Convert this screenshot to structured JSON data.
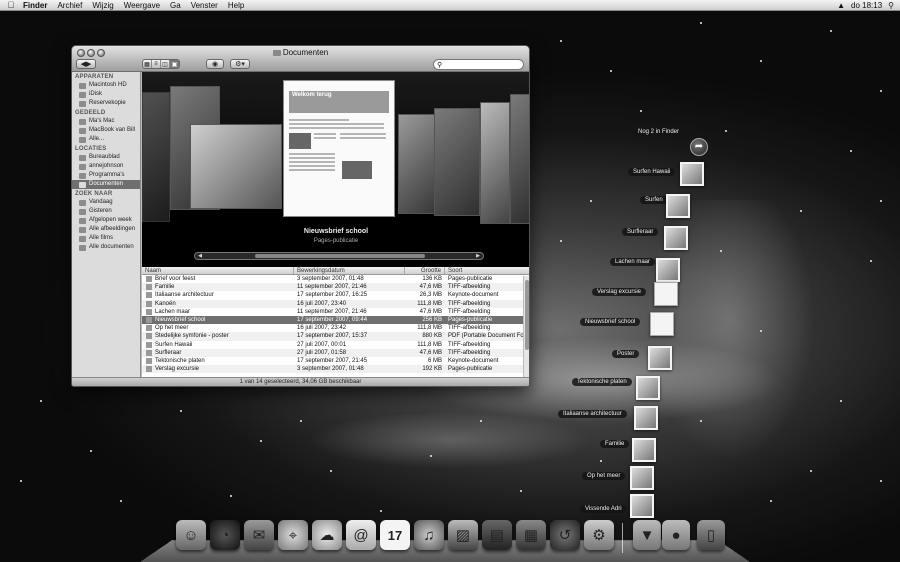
{
  "menubar": {
    "apple_icon": "apple-icon",
    "items": [
      "Finder",
      "Archief",
      "Wijzig",
      "Weergave",
      "Ga",
      "Venster",
      "Help"
    ],
    "clock": "do 18:13",
    "volume_icon": "volume-icon",
    "spotlight_icon": "spotlight-icon"
  },
  "finder": {
    "title": "Documenten",
    "search": {
      "value": "",
      "placeholder": ""
    },
    "sidebar": {
      "sections": [
        {
          "heading": "APPARATEN",
          "items": [
            "Macintosh HD",
            "iDisk",
            "Reservekopie"
          ]
        },
        {
          "heading": "GEDEELD",
          "items": [
            "Ma's Mac",
            "MacBook van Bill",
            "Alle..."
          ]
        },
        {
          "heading": "LOCATIES",
          "items": [
            "Bureaublad",
            "annejohnson",
            "Programma's",
            "Documenten"
          ]
        },
        {
          "heading": "ZOEK NAAR",
          "items": [
            "Vandaag",
            "Gisteren",
            "Afgelopen week",
            "Alle afbeeldingen",
            "Alle films",
            "Alle documenten"
          ]
        }
      ],
      "selected": "Documenten"
    },
    "coverflow": {
      "doc_heading": "Welkom terug",
      "title": "Nieuwsbrief school",
      "subtitle": "Pages-publicatie"
    },
    "columns": {
      "name": "Naam",
      "date": "Bewerkingsdatum",
      "size": "Grootte",
      "kind": "Soort"
    },
    "files": [
      {
        "name": "Brief voor feest",
        "date": "3 september 2007, 01:48",
        "size": "136 KB",
        "kind": "Pages-publicatie"
      },
      {
        "name": "Familie",
        "date": "11 september 2007, 21:46",
        "size": "47,6 MB",
        "kind": "TIFF-afbeelding"
      },
      {
        "name": "Italiaanse architectuur",
        "date": "17 september 2007, 16:25",
        "size": "26,3 MB",
        "kind": "Keynote-document"
      },
      {
        "name": "Kanoën",
        "date": "16 juli 2007, 23:40",
        "size": "111,8 MB",
        "kind": "TIFF-afbeelding"
      },
      {
        "name": "Lachen maar",
        "date": "11 september 2007, 21:46",
        "size": "47,6 MB",
        "kind": "TIFF-afbeelding"
      },
      {
        "name": "Nieuwsbrief school",
        "date": "17 september 2007, 09:44",
        "size": "256 KB",
        "kind": "Pages-publicatie"
      },
      {
        "name": "Op het meer",
        "date": "16 juli 2007, 23:42",
        "size": "111,8 MB",
        "kind": "TIFF-afbeelding"
      },
      {
        "name": "Stedelijke symfonie - poster",
        "date": "17 september 2007, 15:37",
        "size": "880 KB",
        "kind": "PDF (Portable Document Format)"
      },
      {
        "name": "Surfen Hawaii",
        "date": "27 juli 2007, 00:01",
        "size": "111,8 MB",
        "kind": "TIFF-afbeelding"
      },
      {
        "name": "Surfleraar",
        "date": "27 juli 2007, 01:58",
        "size": "47,6 MB",
        "kind": "TIFF-afbeelding"
      },
      {
        "name": "Tektonische platen",
        "date": "17 september 2007, 21:45",
        "size": "6 MB",
        "kind": "Keynote-document"
      },
      {
        "name": "Verslag excursie",
        "date": "3 september 2007, 01:48",
        "size": "192 KB",
        "kind": "Pages-publicatie"
      }
    ],
    "selected_file": "Nieuwsbrief school",
    "status": "1 van 14 geselecteerd, 34,06 GB beschikbaar"
  },
  "stack": {
    "open_in_finder": "Nog 2 in Finder",
    "items": [
      "Surfen Hawaii",
      "Surfen",
      "Surfleraar",
      "Lachen maar",
      "Verslag excursie",
      "Nieuwsbrief school",
      "Poster",
      "Tektonische platen",
      "Italiaanse architectuur",
      "Familie",
      "Op het meer",
      "Vissende Adri"
    ]
  },
  "dock": {
    "apps": [
      "finder-icon",
      "dashboard-icon",
      "mail-icon",
      "safari-icon",
      "ichat-icon",
      "address-book-icon",
      "ical-icon",
      "itunes-icon",
      "iphoto-icon",
      "imovie-icon",
      "spaces-icon",
      "time-machine-icon",
      "system-preferences-icon"
    ],
    "calendar_day": "17",
    "stacks": [
      "documents-stack-icon",
      "downloads-stack-icon",
      "trash-icon"
    ]
  },
  "colors": {
    "selection": "#6f6f6f",
    "menubar": "#e6e6e6",
    "desktop": "#1a1a1a"
  }
}
